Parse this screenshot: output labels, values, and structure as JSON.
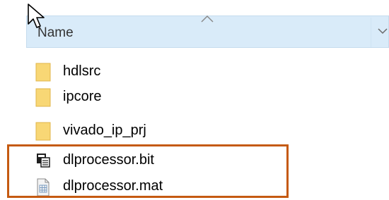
{
  "header": {
    "column_label": "Name"
  },
  "files": [
    {
      "name": "hdlsrc",
      "icon": "folder-icon"
    },
    {
      "name": "ipcore",
      "icon": "folder-icon"
    },
    {
      "name": "vivado_ip_prj",
      "icon": "folder-icon"
    },
    {
      "name": "dlprocessor.bit",
      "icon": "bit-file-icon"
    },
    {
      "name": "dlprocessor.mat",
      "icon": "mat-file-icon"
    }
  ],
  "colors": {
    "header_bg": "#d9ebf9",
    "folder": "#f8d775",
    "highlight_border": "#c55a11"
  }
}
